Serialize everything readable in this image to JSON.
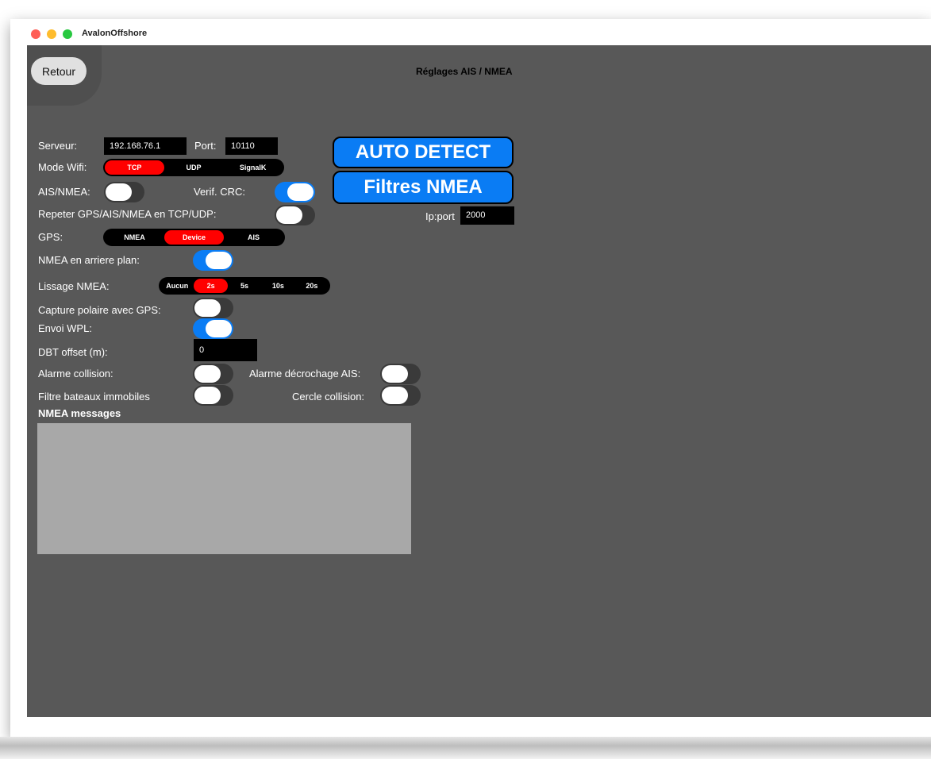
{
  "window": {
    "title": "AvalonOffshore"
  },
  "header": {
    "back_label": "Retour",
    "title": "Réglages AIS / NMEA"
  },
  "network": {
    "server_label": "Serveur:",
    "server_value": "192.168.76.1",
    "port_label": "Port:",
    "port_value": "10110",
    "wifi_mode_label": "Mode Wifi:",
    "wifi_modes": [
      "TCP",
      "UDP",
      "SignalK"
    ],
    "wifi_mode_selected": "TCP"
  },
  "buttons": {
    "auto_detect": "AUTO DETECT",
    "nmea_filters": "Filtres NMEA"
  },
  "ip_port": {
    "label": "Ip:port",
    "value": "2000"
  },
  "toggles": {
    "ais_nmea": {
      "label": "AIS/NMEA:",
      "on": false
    },
    "crc_check": {
      "label": "Verif. CRC:",
      "on": true
    },
    "repeat": {
      "label": "Repeter GPS/AIS/NMEA en TCP/UDP:",
      "on": false
    },
    "background": {
      "label": "NMEA en arriere plan:",
      "on": true
    },
    "polar_capture": {
      "label": "Capture polaire avec GPS:",
      "on": false
    },
    "wpl": {
      "label": "Envoi WPL:",
      "on": true
    },
    "collision_alarm": {
      "label": "Alarme collision:",
      "on": false
    },
    "ais_dropout_alarm": {
      "label": "Alarme décrochage AIS:",
      "on": false
    },
    "still_boats_filter": {
      "label": "Filtre bateaux immobiles",
      "on": false
    },
    "collision_circle": {
      "label": "Cercle collision:",
      "on": false
    }
  },
  "gps": {
    "label": "GPS:",
    "options": [
      "NMEA",
      "Device",
      "AIS"
    ],
    "selected": "Device"
  },
  "smoothing": {
    "label": "Lissage NMEA:",
    "options": [
      "Aucun",
      "2s",
      "5s",
      "10s",
      "20s"
    ],
    "selected": "2s"
  },
  "dbt": {
    "label": "DBT offset (m):",
    "value": "0"
  },
  "messages": {
    "title": "NMEA messages"
  },
  "colors": {
    "accent": "#0a7cf4",
    "selected": "#ff0000",
    "background": "#585858"
  }
}
